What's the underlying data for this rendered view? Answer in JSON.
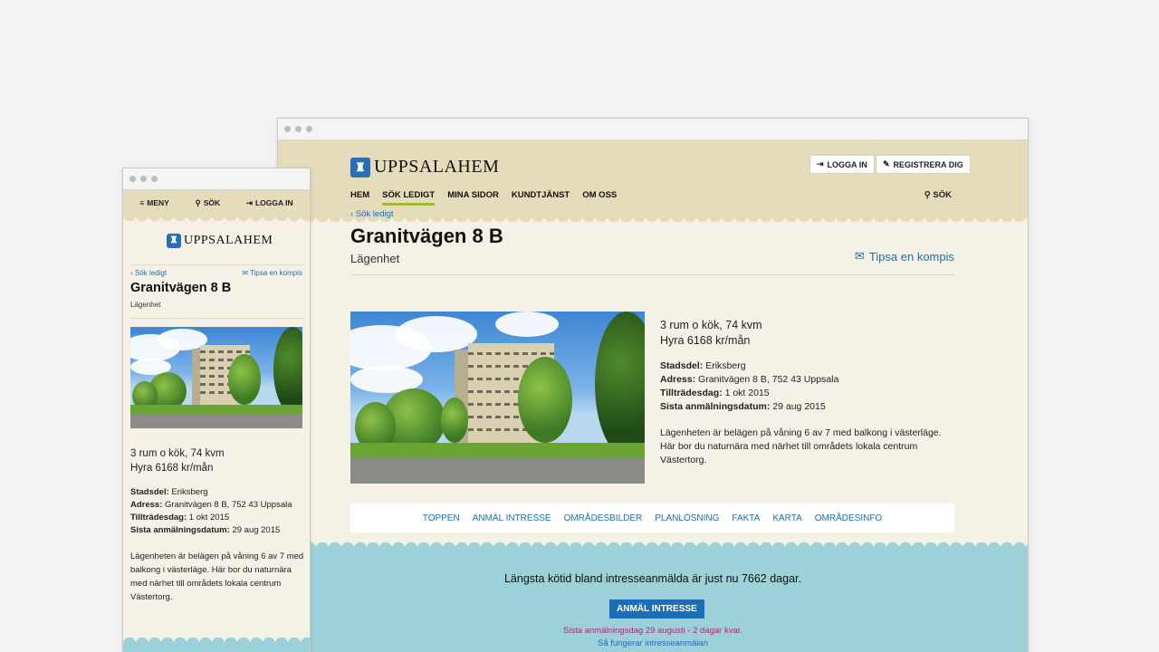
{
  "brand": {
    "name": "UPPSALAHEM"
  },
  "desktop": {
    "header": {
      "login_label": "LOGGA IN",
      "register_label": "REGISTRERA DIG",
      "nav": [
        "HEM",
        "SÖK LEDIGT",
        "MINA SIDOR",
        "KUNDTJÄNST",
        "OM OSS"
      ],
      "active_nav": "SÖK LEDIGT",
      "search_label": "SÖK"
    },
    "back_link": "Sök ledigt",
    "title": "Granitvägen 8 B",
    "subtitle": "Lägenhet",
    "tip_link": "Tipsa en kompis",
    "summary_line1": "3 rum o kök, 74 kvm",
    "summary_line2": "Hyra 6168 kr/mån",
    "facts": [
      {
        "label": "Stadsdel:",
        "value": "Eriksberg"
      },
      {
        "label": "Adress:",
        "value": "Granitvägen 8 B, 752 43 Uppsala"
      },
      {
        "label": "Tillträdesdag:",
        "value": "1 okt 2015"
      },
      {
        "label": "Sista anmälningsdatum:",
        "value": "29 aug 2015"
      }
    ],
    "description": "Lägenheten är belägen på våning 6 av 7 med balkong i västerläge. Här bor du naturnära med närhet till områdets lokala centrum Västertorg.",
    "tabs": [
      "TOPPEN",
      "ANMÄL INTRESSE",
      "OMRÅDESBILDER",
      "PLANLÖSNING",
      "FAKTA",
      "KARTA",
      "OMRÅDESINFO"
    ],
    "queue_text": "Längsta kötid bland intresseanmälda är just nu 7662 dagar.",
    "apply_button": "ANMÄL INTRESSE",
    "deadline_text": "Sista anmälningsdag 29 augusti - 2 dagar kvar.",
    "how_link": "Så fungerar intresseanmälan"
  },
  "mobile": {
    "menu_label": "MENY",
    "search_label": "SÖK",
    "login_label": "LOGGA IN",
    "back_link": "Sök ledigt",
    "tip_link": "Tipsa en kompis",
    "title": "Granitvägen 8 B",
    "subtitle": "Lägenhet",
    "summary_line1": "3 rum o kök, 74 kvm",
    "summary_line2": "Hyra 6168 kr/mån",
    "facts": [
      {
        "label": "Stadsdel:",
        "value": "Eriksberg"
      },
      {
        "label": "Adress:",
        "value": "Granitvägen 8 B, 752 43 Uppsala"
      },
      {
        "label": "Tillträdesdag:",
        "value": "1 okt 2015"
      },
      {
        "label": "Sista anmälningsdatum:",
        "value": "29 aug 2015"
      }
    ],
    "description": "Lägenheten är belägen på våning 6 av 7 med balkong i västerläge. Här bor du naturnära med närhet till områdets lokala centrum Västertorg."
  },
  "colors": {
    "header_bg": "#e4dcba",
    "page_bg": "#f5f1e6",
    "link": "#1a6fb8",
    "accent_underline": "#a6b83e",
    "band_bg": "#9dd1da",
    "deadline": "#a8297a"
  },
  "icons": [
    "login-icon",
    "pencil-icon",
    "search-icon",
    "menu-icon",
    "chevron-left-icon",
    "envelope-icon"
  ]
}
